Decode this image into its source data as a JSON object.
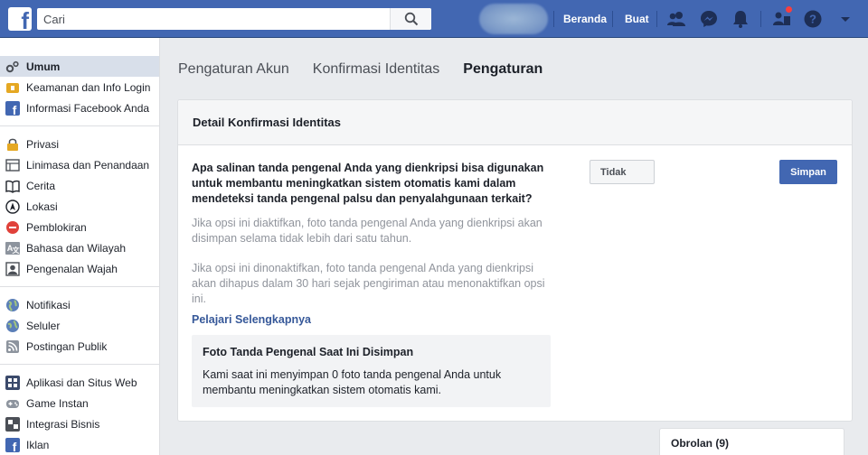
{
  "topbar": {
    "logo": "f",
    "search_placeholder": "Cari",
    "nav_home": "Beranda",
    "nav_create": "Buat",
    "icons": [
      "friends-icon",
      "messenger-icon",
      "bell-icon",
      "friend-requests-icon",
      "help-icon",
      "dropdown-icon"
    ],
    "accent": "#4267b2"
  },
  "sidebar": {
    "groups": [
      [
        {
          "label": "Umum",
          "icon": "gear-icon"
        },
        {
          "label": "Keamanan dan Info Login",
          "icon": "shield-icon"
        },
        {
          "label": "Informasi Facebook Anda",
          "icon": "facebook-icon"
        }
      ],
      [
        {
          "label": "Privasi",
          "icon": "lock-icon"
        },
        {
          "label": "Linimasa dan Penandaan",
          "icon": "timeline-icon"
        },
        {
          "label": "Cerita",
          "icon": "book-icon"
        },
        {
          "label": "Lokasi",
          "icon": "location-icon"
        },
        {
          "label": "Pemblokiran",
          "icon": "block-icon"
        },
        {
          "label": "Bahasa dan Wilayah",
          "icon": "language-icon"
        },
        {
          "label": "Pengenalan Wajah",
          "icon": "face-icon"
        }
      ],
      [
        {
          "label": "Notifikasi",
          "icon": "globe-icon"
        },
        {
          "label": "Seluler",
          "icon": "mobile-icon"
        },
        {
          "label": "Postingan Publik",
          "icon": "rss-icon"
        }
      ],
      [
        {
          "label": "Aplikasi dan Situs Web",
          "icon": "apps-icon"
        },
        {
          "label": "Game Instan",
          "icon": "game-icon"
        },
        {
          "label": "Integrasi Bisnis",
          "icon": "business-icon"
        },
        {
          "label": "Iklan",
          "icon": "ads-icon"
        }
      ]
    ]
  },
  "tabs": [
    "Pengaturan Akun",
    "Konfirmasi Identitas",
    "Pengaturan"
  ],
  "card": {
    "header": "Detail Konfirmasi Identitas",
    "question": "Apa salinan tanda pengenal Anda yang dienkripsi bisa digunakan untuk membantu meningkatkan sistem otomatis kami dalam mendeteksi tanda pengenal palsu dan penyalahgunaan terkait?",
    "desc_on": "Jika opsi ini diaktifkan, foto tanda pengenal Anda yang dienkripsi akan disimpan selama tidak lebih dari satu tahun.",
    "desc_off": "Jika opsi ini dinonaktifkan, foto tanda pengenal Anda yang dienkripsi akan dihapus dalam 30 hari sejak pengiriman atau menonaktifkan opsi ini.",
    "learn_more": "Pelajari Selengkapnya",
    "select_value": "Tidak",
    "save_label": "Simpan",
    "info_title": "Foto Tanda Pengenal Saat Ini Disimpan",
    "info_text": "Kami saat ini menyimpan 0 foto tanda pengenal Anda untuk membantu meningkatkan sistem otomatis kami."
  },
  "chat": {
    "label": "Obrolan (9)"
  }
}
